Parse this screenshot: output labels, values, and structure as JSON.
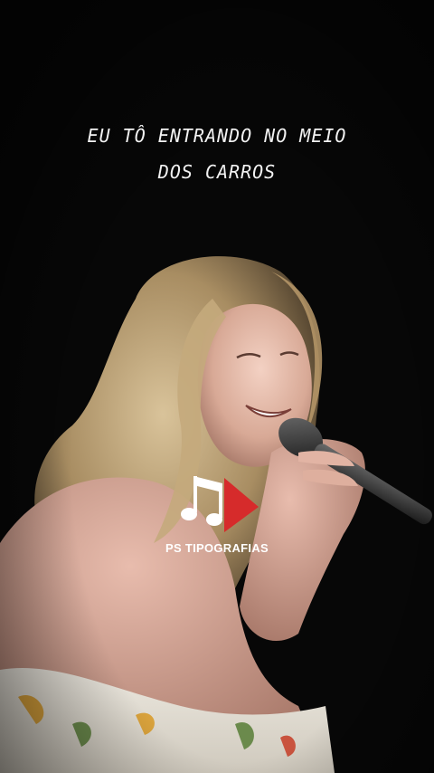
{
  "lyric": {
    "line1": "EU TÔ ENTRANDO NO MEIO",
    "line2": "DOS CARROS"
  },
  "brand": {
    "name": "PS TIPOGRAFIAS",
    "icon": "music-note-play-icon",
    "accent_color": "#d62b2b"
  },
  "background": {
    "color": "#070707",
    "image": "singer-with-microphone"
  }
}
